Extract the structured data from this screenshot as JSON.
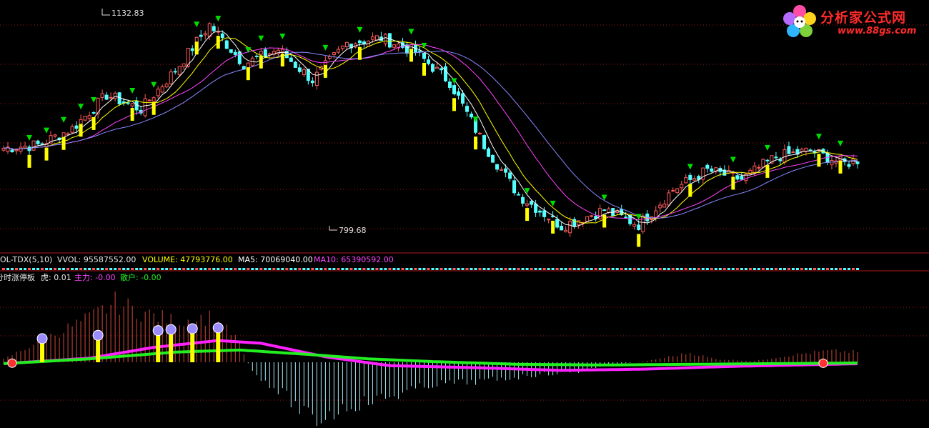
{
  "logo": {
    "brand": "分析家公式网",
    "site": "www.88gs.com"
  },
  "price_panel": {
    "high_label": "1132.83",
    "low_label": "799.68"
  },
  "volume_panel": {
    "name": "OL-TDX(5,10)",
    "vvol": "VVOL: 95587552.00",
    "volume": "VOLUME: 47793776.00",
    "ma5": "MA5: 70069040.00",
    "ma10": "MA10: 65390592.00"
  },
  "indicator_panel": {
    "name": "分时涨停板",
    "tiger": "虎: 0.01",
    "main": "主力: -0.00",
    "retail": "散户: -0.00"
  },
  "colors": {
    "up": "#ff5a5a",
    "down": "#54ffff",
    "ma_white": "#ffffff",
    "ma_yellow": "#ffff00",
    "ma_magenta": "#ff44ff",
    "ma_blue": "#8888ff",
    "signal_bar": "#ffff00",
    "green_line": "#22ee22",
    "magenta_line": "#ff22ff",
    "grid": "#a01818",
    "arrow": "#00dd00"
  },
  "chart_data": [
    {
      "type": "candlestick",
      "title": "",
      "ylim": [
        795,
        1145
      ],
      "price_axis_labels": [
        "1132.83",
        "799.68"
      ],
      "overall_high": 1132.83,
      "overall_low": 799.68,
      "n_bars": 200,
      "close_key_points": [
        [
          0,
          930
        ],
        [
          8,
          935
        ],
        [
          16,
          960
        ],
        [
          24,
          1012
        ],
        [
          32,
          990
        ],
        [
          40,
          1050
        ],
        [
          48,
          1120
        ],
        [
          56,
          1060
        ],
        [
          64,
          1082
        ],
        [
          72,
          1035
        ],
        [
          80,
          1092
        ],
        [
          88,
          1100
        ],
        [
          96,
          1078
        ],
        [
          104,
          1032
        ],
        [
          112,
          935
        ],
        [
          120,
          858
        ],
        [
          130,
          810
        ],
        [
          140,
          835
        ],
        [
          148,
          812
        ],
        [
          156,
          866
        ],
        [
          164,
          896
        ],
        [
          172,
          882
        ],
        [
          180,
          917
        ],
        [
          188,
          926
        ],
        [
          196,
          906
        ],
        [
          200,
          914
        ]
      ],
      "candles_note": "synthetic daily candles generated from close_key_points with deterministic noise",
      "signal_bar_indices": [
        6,
        10,
        14,
        18,
        21,
        30,
        35,
        45,
        50,
        57,
        60,
        65,
        75,
        83,
        95,
        98,
        105,
        110,
        122,
        128,
        140,
        148,
        160,
        170,
        178,
        190,
        195
      ]
    },
    {
      "type": "bar",
      "title": "OL-TDX(5,10)",
      "series_names": [
        "VVOL",
        "VOLUME",
        "MA5",
        "MA10"
      ],
      "last_values": {
        "VVOL": 95587552.0,
        "VOLUME": 47793776.0,
        "MA5": 70069040.0,
        "MA10": 65390592.0
      }
    },
    {
      "type": "bar",
      "title": "分时涨停板",
      "last_values": {
        "虎": 0.01,
        "主力": -0.0,
        "散户": -0.0
      },
      "ylim": [
        -1,
        1
      ],
      "histogram_key_points": [
        [
          0,
          0.05
        ],
        [
          6,
          0.25
        ],
        [
          12,
          0.45
        ],
        [
          20,
          0.7
        ],
        [
          26,
          0.95
        ],
        [
          32,
          0.8
        ],
        [
          40,
          0.65
        ],
        [
          48,
          0.72
        ],
        [
          54,
          0.4
        ],
        [
          58,
          -0.15
        ],
        [
          66,
          -0.55
        ],
        [
          72,
          -0.95
        ],
        [
          80,
          -0.7
        ],
        [
          90,
          -0.55
        ],
        [
          100,
          -0.35
        ],
        [
          112,
          -0.3
        ],
        [
          124,
          -0.2
        ],
        [
          134,
          -0.15
        ],
        [
          140,
          -0.05
        ],
        [
          150,
          0.02
        ],
        [
          160,
          0.15
        ],
        [
          166,
          0.05
        ],
        [
          175,
          0.02
        ],
        [
          184,
          0.12
        ],
        [
          192,
          0.18
        ],
        [
          200,
          0.16
        ]
      ],
      "green_line_key_points": [
        [
          0,
          -0.02
        ],
        [
          20,
          0.05
        ],
        [
          40,
          0.15
        ],
        [
          55,
          0.18
        ],
        [
          70,
          0.12
        ],
        [
          85,
          0.05
        ],
        [
          100,
          0.01
        ],
        [
          120,
          -0.03
        ],
        [
          140,
          -0.04
        ],
        [
          160,
          -0.03
        ],
        [
          180,
          -0.02
        ],
        [
          200,
          -0.01
        ]
      ],
      "magenta_line_key_points": [
        [
          0,
          -0.02
        ],
        [
          20,
          0.06
        ],
        [
          35,
          0.22
        ],
        [
          50,
          0.32
        ],
        [
          60,
          0.28
        ],
        [
          75,
          0.08
        ],
        [
          90,
          -0.05
        ],
        [
          110,
          -0.08
        ],
        [
          130,
          -0.12
        ],
        [
          150,
          -0.1
        ],
        [
          170,
          -0.06
        ],
        [
          200,
          -0.02
        ]
      ],
      "signal_bar_indices": [
        9,
        22,
        36,
        39,
        44,
        50
      ]
    }
  ]
}
